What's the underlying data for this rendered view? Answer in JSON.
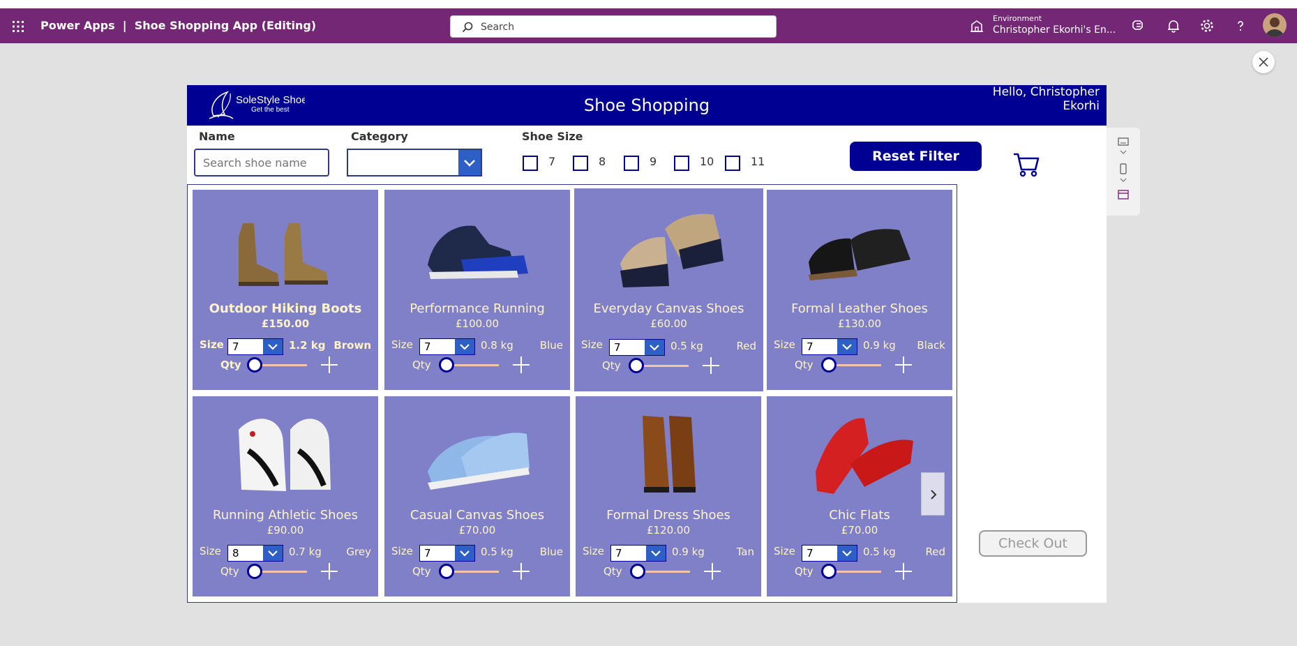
{
  "topbar": {
    "title": "Power Apps  |  Shoe Shopping App (Editing)",
    "search_placeholder": "Search",
    "environment_label": "Environment",
    "environment_name": "Christopher Ekorhi's En...",
    "accent": "#742774"
  },
  "app": {
    "logo_brand": "SoleStyle Shoe",
    "logo_tagline": "Get the best",
    "title": "Shoe Shopping",
    "greeting_line1": "Hello, Christopher",
    "greeting_line2": "Ekorhi",
    "filters": {
      "name_label": "Name",
      "name_placeholder": "Search shoe name",
      "category_label": "Category",
      "size_label": "Shoe Size",
      "sizes": [
        "7",
        "8",
        "9",
        "10",
        "11"
      ],
      "reset_label": "Reset Filter"
    },
    "size_label": "Size",
    "qty_label": "Qty",
    "checkout_label": "Check Out",
    "products": [
      {
        "name": "Outdoor Hiking Boots",
        "price": "£150.00",
        "size": "7",
        "weight": "1.2 kg",
        "color": "Brown",
        "qty": 0
      },
      {
        "name": "Performance Running",
        "price": "£100.00",
        "size": "7",
        "weight": "0.8 kg",
        "color": "Blue",
        "qty": 0
      },
      {
        "name": "Everyday Canvas Shoes",
        "price": "£60.00",
        "size": "7",
        "weight": "0.5 kg",
        "color": "Red",
        "qty": 0
      },
      {
        "name": "Formal Leather Shoes",
        "price": "£130.00",
        "size": "7",
        "weight": "0.9 kg",
        "color": "Black",
        "qty": 0
      },
      {
        "name": "Running Athletic Shoes",
        "price": "£90.00",
        "size": "8",
        "weight": "0.7 kg",
        "color": "Grey",
        "qty": 0
      },
      {
        "name": "Casual Canvas Shoes",
        "price": "£70.00",
        "size": "7",
        "weight": "0.5 kg",
        "color": "Blue",
        "qty": 0
      },
      {
        "name": "Formal Dress Shoes",
        "price": "£120.00",
        "size": "7",
        "weight": "0.9 kg",
        "color": "Tan",
        "qty": 0
      },
      {
        "name": "Chic Flats",
        "price": "£70.00",
        "size": "7",
        "weight": "0.5 kg",
        "color": "Red",
        "qty": 0
      }
    ]
  }
}
